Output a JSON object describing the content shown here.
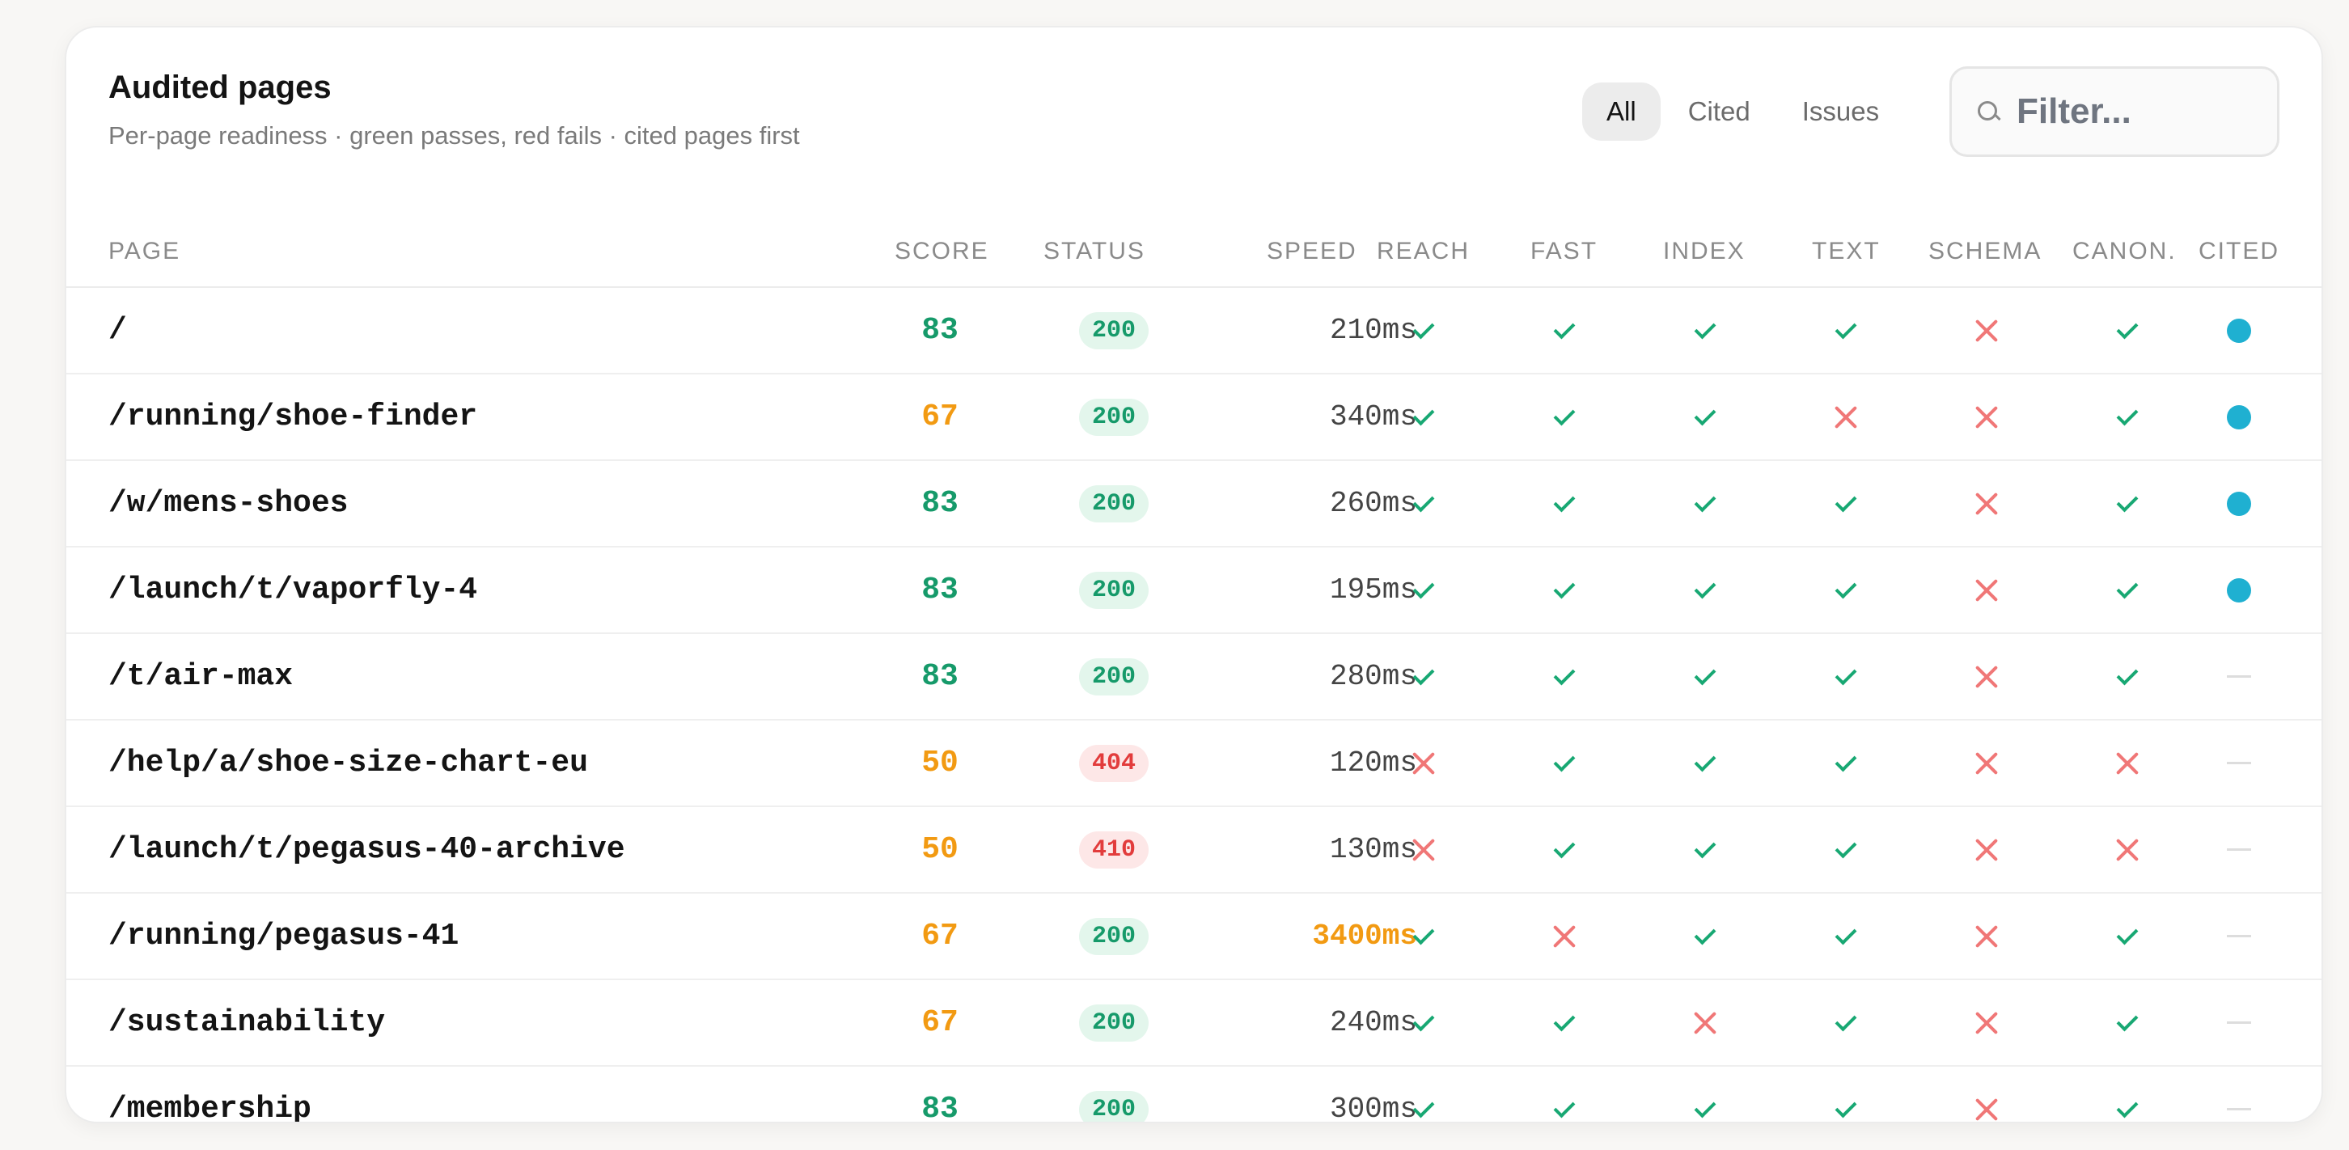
{
  "header": {
    "title": "Audited pages",
    "subtitle": "Per-page readiness · green passes, red fails · cited pages first"
  },
  "filters": {
    "tabs": [
      "All",
      "Cited",
      "Issues"
    ],
    "active": "All",
    "search_placeholder": "Filter..."
  },
  "columns": {
    "page": "PAGE",
    "score": "SCORE",
    "status": "STATUS",
    "speed": "SPEED",
    "reach": "REACH",
    "fast": "FAST",
    "index": "INDEX",
    "text": "TEXT",
    "schema": "SCHEMA",
    "canon": "CANON.",
    "cited": "CITED"
  },
  "colors": {
    "good": "#169a6a",
    "warn": "#f29a12",
    "fail": "#f07777",
    "cited": "#1fb0d1"
  },
  "rows": [
    {
      "page": "/",
      "score": "83",
      "score_level": "good",
      "status": "200",
      "speed": "210ms",
      "slow": false,
      "checks": [
        true,
        true,
        true,
        true,
        false,
        true
      ],
      "cited": true
    },
    {
      "page": "/running/shoe-finder",
      "score": "67",
      "score_level": "warn",
      "status": "200",
      "speed": "340ms",
      "slow": false,
      "checks": [
        true,
        true,
        true,
        false,
        false,
        true
      ],
      "cited": true
    },
    {
      "page": "/w/mens-shoes",
      "score": "83",
      "score_level": "good",
      "status": "200",
      "speed": "260ms",
      "slow": false,
      "checks": [
        true,
        true,
        true,
        true,
        false,
        true
      ],
      "cited": true
    },
    {
      "page": "/launch/t/vaporfly-4",
      "score": "83",
      "score_level": "good",
      "status": "200",
      "speed": "195ms",
      "slow": false,
      "checks": [
        true,
        true,
        true,
        true,
        false,
        true
      ],
      "cited": true
    },
    {
      "page": "/t/air-max",
      "score": "83",
      "score_level": "good",
      "status": "200",
      "speed": "280ms",
      "slow": false,
      "checks": [
        true,
        true,
        true,
        true,
        false,
        true
      ],
      "cited": false
    },
    {
      "page": "/help/a/shoe-size-chart-eu",
      "score": "50",
      "score_level": "warn",
      "status": "404",
      "speed": "120ms",
      "slow": false,
      "checks": [
        false,
        true,
        true,
        true,
        false,
        false
      ],
      "cited": false
    },
    {
      "page": "/launch/t/pegasus-40-archive",
      "score": "50",
      "score_level": "warn",
      "status": "410",
      "speed": "130ms",
      "slow": false,
      "checks": [
        false,
        true,
        true,
        true,
        false,
        false
      ],
      "cited": false
    },
    {
      "page": "/running/pegasus-41",
      "score": "67",
      "score_level": "warn",
      "status": "200",
      "speed": "3400ms",
      "slow": true,
      "checks": [
        true,
        false,
        true,
        true,
        false,
        true
      ],
      "cited": false
    },
    {
      "page": "/sustainability",
      "score": "67",
      "score_level": "warn",
      "status": "200",
      "speed": "240ms",
      "slow": false,
      "checks": [
        true,
        true,
        false,
        true,
        false,
        true
      ],
      "cited": false
    },
    {
      "page": "/membership",
      "score": "83",
      "score_level": "good",
      "status": "200",
      "speed": "300ms",
      "slow": false,
      "checks": [
        true,
        true,
        true,
        true,
        false,
        true
      ],
      "cited": false
    }
  ]
}
